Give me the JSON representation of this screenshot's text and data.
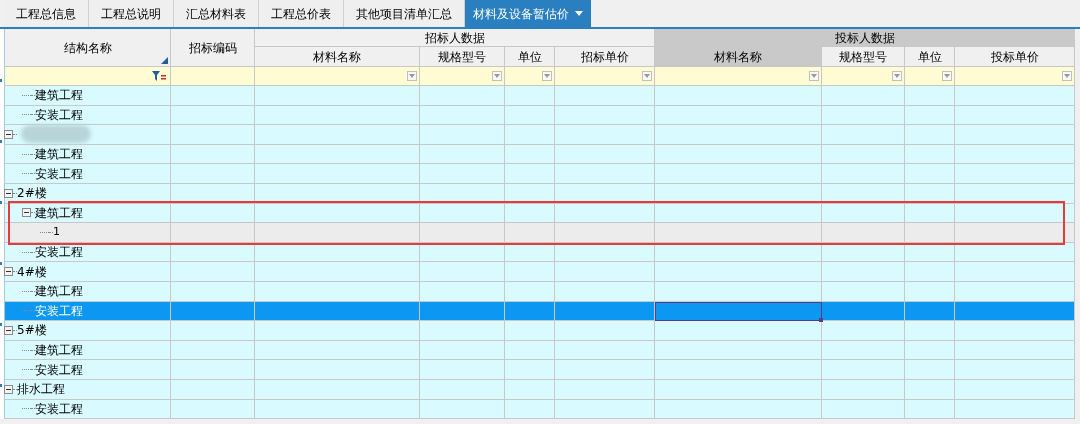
{
  "tabs": [
    {
      "label": "工程总信息",
      "selected": false
    },
    {
      "label": "工程总说明",
      "selected": false
    },
    {
      "label": "汇总材料表",
      "selected": false
    },
    {
      "label": "工程总价表",
      "selected": false
    },
    {
      "label": "其他项目清单汇总",
      "selected": false
    },
    {
      "label": "材料及设备暂估价",
      "selected": true
    }
  ],
  "table": {
    "columns": [
      {
        "title": "结构名称",
        "filter": true
      },
      {
        "title": "招标编码",
        "filter": false
      }
    ],
    "groups": [
      {
        "title": "招标人数据",
        "highlighted": false,
        "columns": [
          {
            "title": "材料名称",
            "highlighted": false,
            "cursor": false
          },
          {
            "title": "规格型号",
            "highlighted": false,
            "cursor": false
          },
          {
            "title": "单位",
            "highlighted": false,
            "cursor": false
          },
          {
            "title": "招标单价",
            "highlighted": false,
            "cursor": false
          }
        ]
      },
      {
        "title": "投标人数据",
        "highlighted": true,
        "columns": [
          {
            "title": "材料名称",
            "highlighted": true,
            "cursor": true
          },
          {
            "title": "规格型号",
            "highlighted": false,
            "cursor": false
          },
          {
            "title": "单位",
            "highlighted": false,
            "cursor": false
          },
          {
            "title": "投标单价",
            "highlighted": false,
            "cursor": false
          }
        ]
      }
    ],
    "tree": [
      {
        "kind": "offscreen",
        "children": [
          {
            "label": "建筑工程",
            "selected": false,
            "framed": false
          },
          {
            "label": "安装工程",
            "selected": false,
            "framed": false
          }
        ]
      },
      {
        "kind": "redacted",
        "expanded": true,
        "selected": false,
        "framed": false,
        "children": [
          {
            "label": "建筑工程",
            "selected": false,
            "framed": false
          },
          {
            "label": "安装工程",
            "selected": false,
            "framed": false
          }
        ]
      },
      {
        "label": "2#楼",
        "expanded": true,
        "selected": false,
        "framed": false,
        "children": [
          {
            "label": "建筑工程",
            "expanded": true,
            "selected": false,
            "framed": true,
            "children": [
              {
                "label": "1",
                "selected": false,
                "framed": true,
                "kind": "detail"
              }
            ]
          },
          {
            "label": "安装工程",
            "selected": false,
            "framed": false
          }
        ]
      },
      {
        "label": "4#楼",
        "expanded": true,
        "selected": false,
        "framed": false,
        "children": [
          {
            "label": "建筑工程",
            "selected": false,
            "framed": false
          },
          {
            "label": "安装工程",
            "selected": true,
            "framed": false
          }
        ]
      },
      {
        "label": "5#楼",
        "expanded": true,
        "selected": false,
        "framed": false,
        "children": [
          {
            "label": "建筑工程",
            "selected": false,
            "framed": false
          },
          {
            "label": "安装工程",
            "selected": false,
            "framed": false
          }
        ]
      },
      {
        "label": "排水工程",
        "expanded": true,
        "selected": false,
        "framed": false,
        "children": [
          {
            "label": "安装工程",
            "selected": false,
            "framed": false
          }
        ]
      }
    ]
  }
}
